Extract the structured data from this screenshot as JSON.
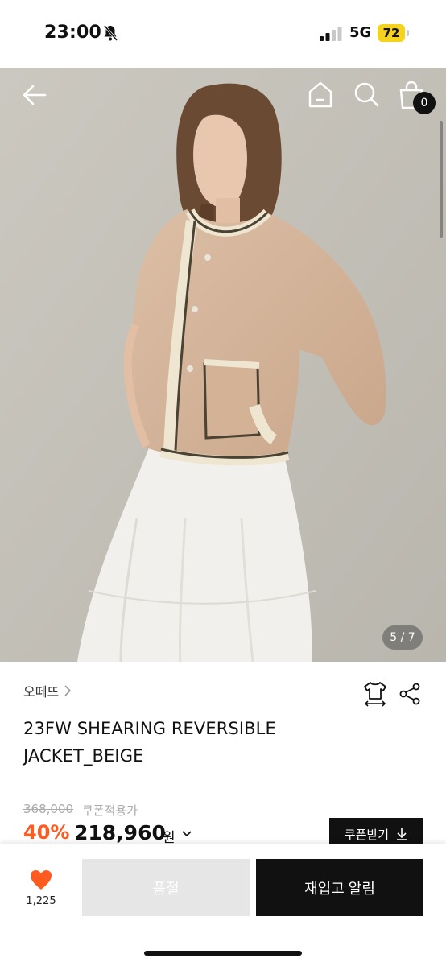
{
  "status_bar": {
    "time": "23:00",
    "network": "5G",
    "battery": "72"
  },
  "header": {
    "cart_count": "0"
  },
  "gallery": {
    "counter": "5 / 7"
  },
  "product": {
    "brand": "오떼뜨",
    "title_line1": "23FW SHEARING REVERSIBLE",
    "title_line2": "JACKET_BEIGE",
    "original_price": "368,000",
    "coupon_note": "쿠폰적용가",
    "discount_rate": "40%",
    "sale_price": "218,960",
    "currency_unit": "원",
    "coupon_button": "쿠폰받기"
  },
  "bottom_bar": {
    "like_count": "1,225",
    "soldout_label": "품절",
    "restock_label": "재입고 알림"
  },
  "colors": {
    "accent": "#ff5a1f",
    "battery": "#f5d21c",
    "dark": "#111111"
  }
}
